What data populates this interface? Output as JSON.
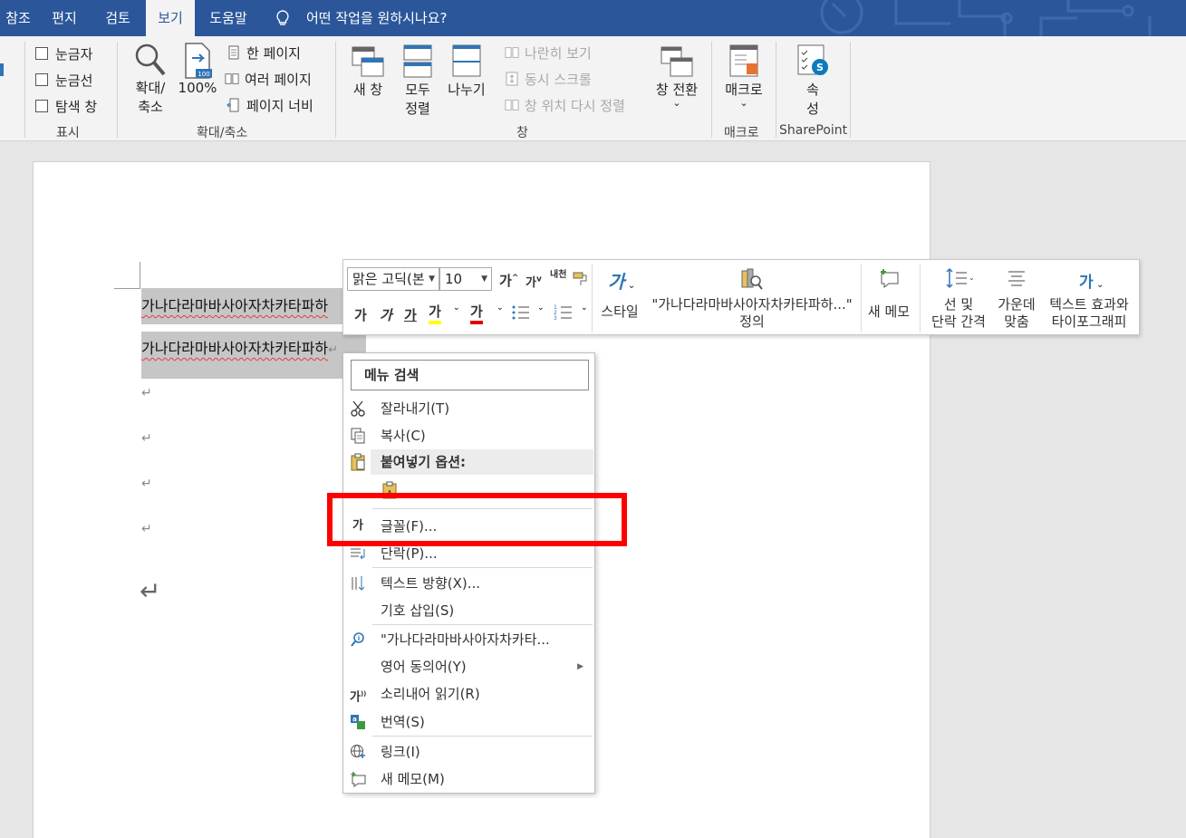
{
  "tabs": [
    {
      "label": "참조",
      "active": false
    },
    {
      "label": "편지",
      "active": false
    },
    {
      "label": "검토",
      "active": false
    },
    {
      "label": "보기",
      "active": true
    },
    {
      "label": "도움말",
      "active": false
    }
  ],
  "tell_me": "어떤 작업을 원하시나요?",
  "ribbon": {
    "show": {
      "label": "표시",
      "ruler": "눈금자",
      "gridlines": "눈금선",
      "nav_pane": "탐색 창"
    },
    "zoom": {
      "label": "확대/축소",
      "zoom_line1": "확대/",
      "zoom_line2": "축소",
      "hundred": "100%",
      "one_page": "한 페이지",
      "multi_page": "여러 페이지",
      "page_width": "페이지 너비"
    },
    "window": {
      "label": "창",
      "new_window": "새 창",
      "arrange_line1": "모두",
      "arrange_line2": "정렬",
      "split": "나누기",
      "side_by_side": "나란히 보기",
      "sync_scroll": "동시 스크롤",
      "reset_pos": "창 위치 다시 정렬",
      "switch": "창 전환",
      "switch_arrow": "⌄"
    },
    "macros": {
      "label": "매크로",
      "button": "매크로",
      "arrow": "⌄"
    },
    "sharepoint": {
      "label": "SharePoint",
      "prop_line1": "속",
      "prop_line2": "성"
    }
  },
  "document": {
    "line1": "가나다라마바사아자차카타파하",
    "line2": "가나다라마바사아자차카타파하",
    "para_mark": "↵",
    "end_mark": "↵"
  },
  "mini_toolbar": {
    "font_name": "맑은 고딕(본",
    "font_size": "10",
    "grow": "가",
    "shrink": "가",
    "phonetic": "내천",
    "bold": "가",
    "italic": "가",
    "underline": "가",
    "highlight": "가",
    "font_color": "가",
    "styles": "스타일",
    "define_line1": "\"가나다라마바사아자차카타파하...\"",
    "define_line2": "정의",
    "new_comment": "새 메모",
    "spacing_line1": "선 및",
    "spacing_line2": "단락 간격",
    "center_line1": "가운데",
    "center_line2": "맞춤",
    "effects_line1": "텍스트 효과와",
    "effects_line2": "타이포그래피"
  },
  "context_menu": {
    "search": "메뉴 검색",
    "items": [
      {
        "label": "잘라내기(T)",
        "icon": "scissors-icon"
      },
      {
        "label": "복사(C)",
        "icon": "copy-icon"
      },
      {
        "label": "붙여넣기 옵션:",
        "icon": "paste-icon"
      },
      {
        "label": "",
        "icon": "paste-keep-text-icon"
      },
      {
        "label": "글꼴(F)...",
        "icon": "font-icon",
        "icon_text": "가"
      },
      {
        "label": "단락(P)...",
        "icon": "paragraph-icon"
      },
      {
        "label": "텍스트 방향(X)...",
        "icon": "text-direction-icon"
      },
      {
        "label": "기호 삽입(S)",
        "icon": ""
      },
      {
        "label": "\"가나다라마바사아자차카타...",
        "icon": "smart-lookup-icon"
      },
      {
        "label": "영어 동의어(Y)",
        "icon": "",
        "submenu": "▶"
      },
      {
        "label": "소리내어 읽기(R)",
        "icon": "read-aloud-icon",
        "icon_text": "가"
      },
      {
        "label": "번역(S)",
        "icon": "translate-icon"
      },
      {
        "label": "링크(I)",
        "icon": "link-icon"
      },
      {
        "label": "새 메모(M)",
        "icon": "new-comment-icon"
      }
    ]
  },
  "colors": {
    "tab_blue": "#2b579a",
    "highlight_box": "#ff0000",
    "selection": "#c6c6c6",
    "accent_blue": "#2e75b6"
  }
}
